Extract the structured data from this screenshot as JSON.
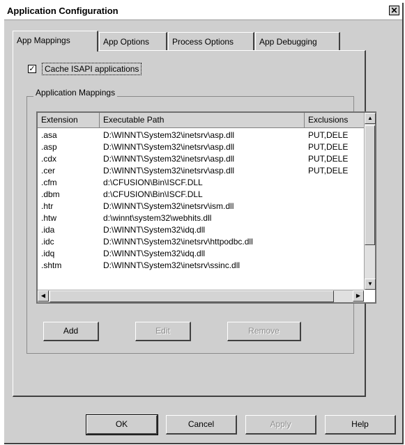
{
  "window": {
    "title": "Application Configuration",
    "close_glyph": "✕"
  },
  "tabs": [
    "App Mappings",
    "App Options",
    "Process Options",
    "App Debugging"
  ],
  "cache_checkbox": {
    "label": "Cache ISAPI applications",
    "checked": true,
    "mark": "✓"
  },
  "mappings_group": {
    "title": "Application Mappings"
  },
  "list": {
    "columns": [
      "Extension",
      "Executable Path",
      "Exclusions"
    ],
    "rows": [
      {
        "ext": ".asa",
        "path": "D:\\WINNT\\System32\\inetsrv\\asp.dll",
        "excl": "PUT,DELE"
      },
      {
        "ext": ".asp",
        "path": "D:\\WINNT\\System32\\inetsrv\\asp.dll",
        "excl": "PUT,DELE"
      },
      {
        "ext": ".cdx",
        "path": "D:\\WINNT\\System32\\inetsrv\\asp.dll",
        "excl": "PUT,DELE"
      },
      {
        "ext": ".cer",
        "path": "D:\\WINNT\\System32\\inetsrv\\asp.dll",
        "excl": "PUT,DELE"
      },
      {
        "ext": ".cfm",
        "path": "d:\\CFUSION\\Bin\\ISCF.DLL",
        "excl": ""
      },
      {
        "ext": ".dbm",
        "path": "d:\\CFUSION\\Bin\\ISCF.DLL",
        "excl": ""
      },
      {
        "ext": ".htr",
        "path": "D:\\WINNT\\System32\\inetsrv\\ism.dll",
        "excl": ""
      },
      {
        "ext": ".htw",
        "path": "d:\\winnt\\system32\\webhits.dll",
        "excl": ""
      },
      {
        "ext": ".ida",
        "path": "D:\\WINNT\\System32\\idq.dll",
        "excl": ""
      },
      {
        "ext": ".idc",
        "path": "D:\\WINNT\\System32\\inetsrv\\httpodbc.dll",
        "excl": ""
      },
      {
        "ext": ".idq",
        "path": "D:\\WINNT\\System32\\idq.dll",
        "excl": ""
      },
      {
        "ext": ".shtm",
        "path": "D:\\WINNT\\System32\\inetsrv\\ssinc.dll",
        "excl": ""
      }
    ]
  },
  "list_buttons": {
    "add": "Add",
    "edit": "Edit",
    "remove": "Remove"
  },
  "dialog_buttons": {
    "ok": "OK",
    "cancel": "Cancel",
    "apply": "Apply",
    "help": "Help"
  },
  "scroll_glyphs": {
    "up": "▲",
    "down": "▼",
    "left": "◀",
    "right": "▶"
  }
}
